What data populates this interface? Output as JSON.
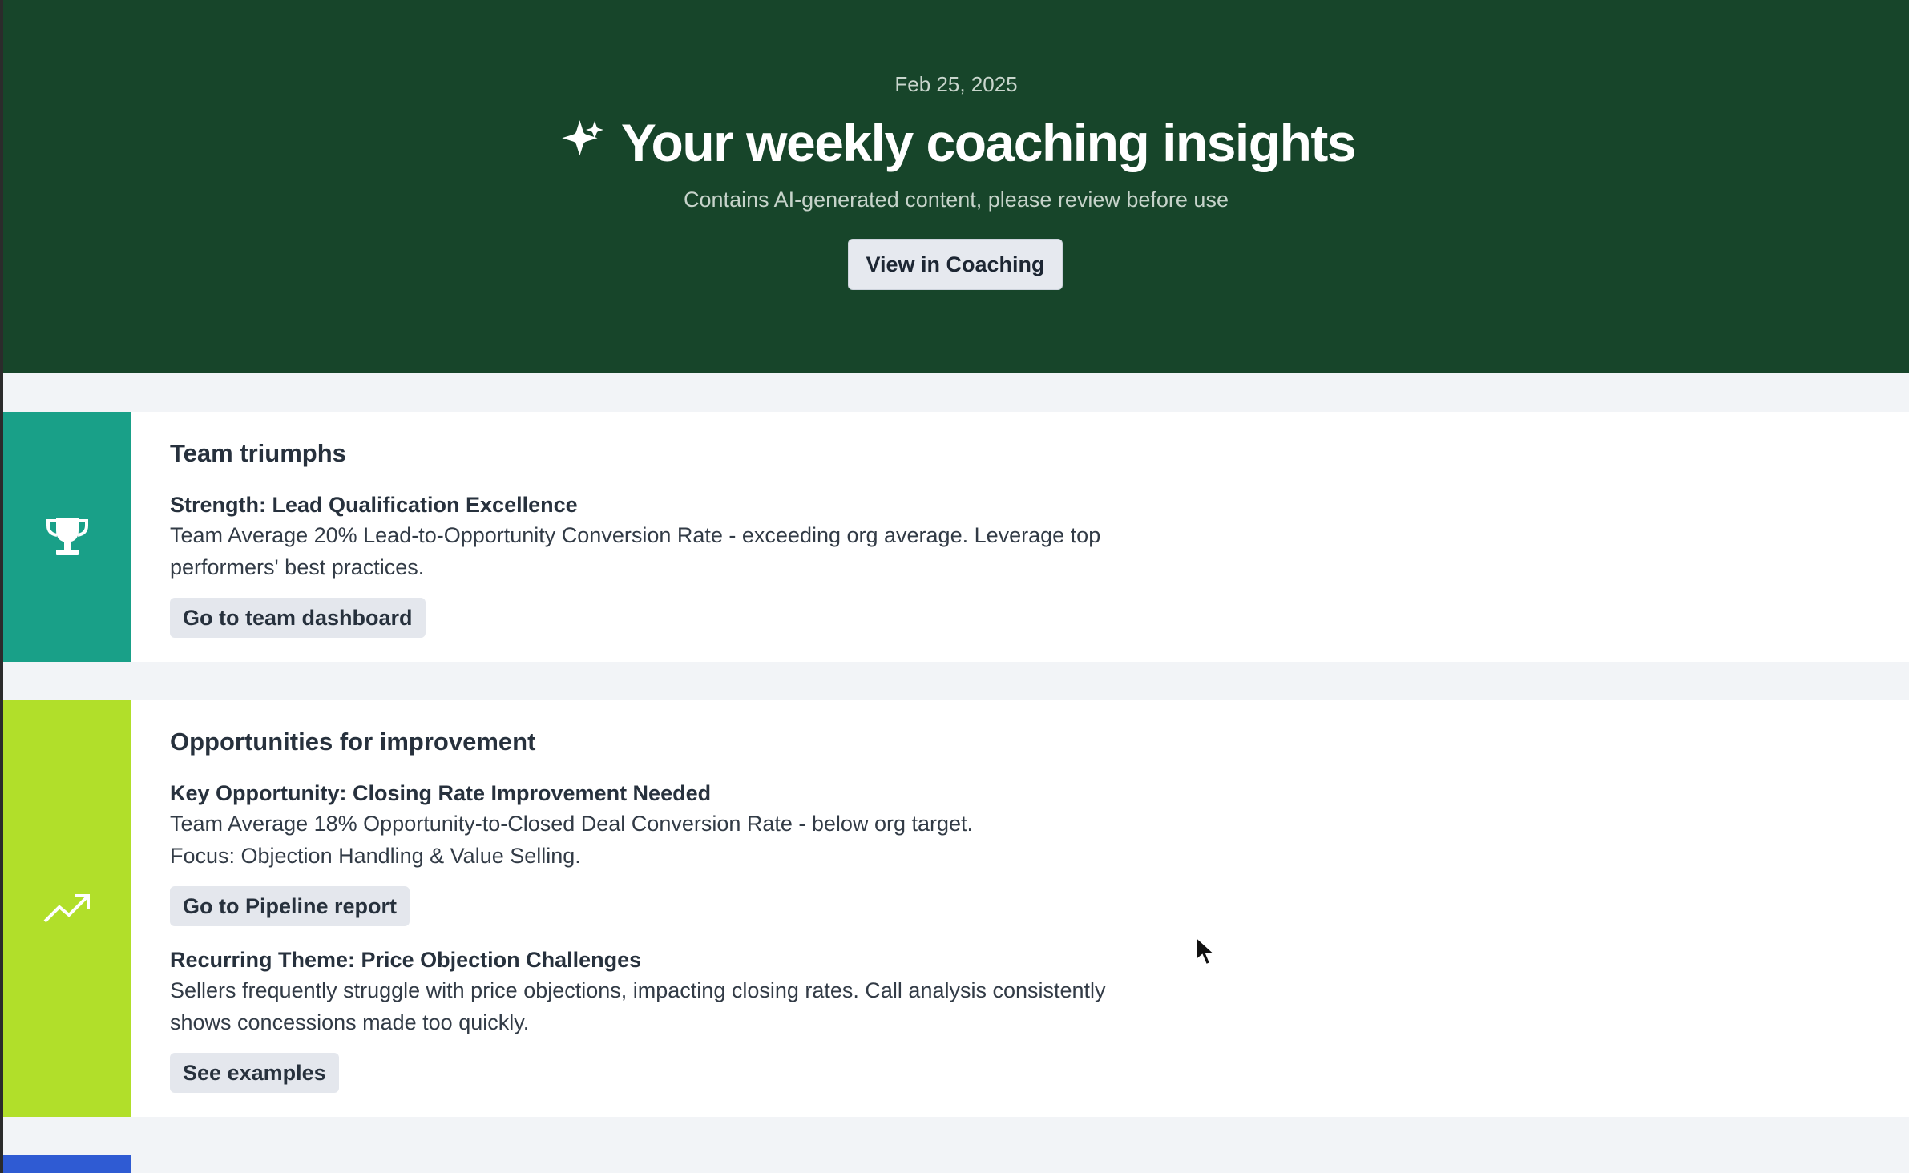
{
  "header": {
    "date": "Feb 25, 2025",
    "title": "Your weekly coaching insights",
    "subtitle": "Contains AI-generated content, please review before use",
    "view_button": "View in Coaching",
    "background_color": "#17452a"
  },
  "sections": [
    {
      "title": "Team triumphs",
      "band_color": "#19a088",
      "icon": "trophy-icon",
      "items": [
        {
          "title": "Strength: Lead Qualification Excellence",
          "text": "Team Average 20% Lead-to-Opportunity Conversion Rate - exceeding org average. Leverage top performers' best practices.",
          "action": "Go to team dashboard"
        }
      ]
    },
    {
      "title": "Opportunities for improvement",
      "band_color": "#b1df2a",
      "icon": "trending-up-icon",
      "items": [
        {
          "title": "Key Opportunity: Closing Rate Improvement Needed",
          "text_lines": [
            "Team Average 18% Opportunity-to-Closed Deal Conversion Rate - below org target.",
            "Focus: Objection Handling & Value Selling."
          ],
          "action": "Go to Pipeline report"
        },
        {
          "title": "Recurring Theme: Price Objection Challenges",
          "text": "Sellers frequently struggle with price objections, impacting closing rates. Call analysis consistently shows concessions made too quickly.",
          "action": "See examples"
        }
      ]
    }
  ],
  "next_section_band_color": "#2f5bd3"
}
